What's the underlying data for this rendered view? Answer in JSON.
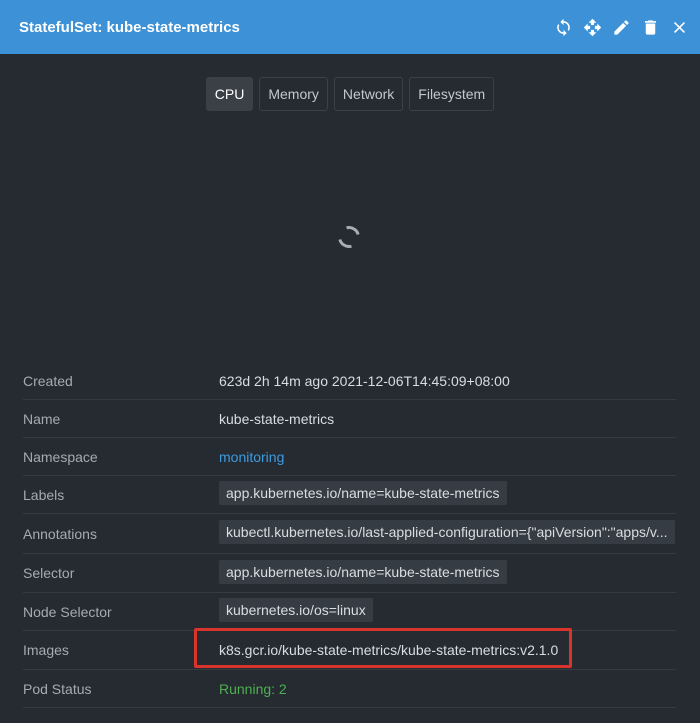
{
  "header": {
    "title": "StatefulSet: kube-state-metrics",
    "actions": [
      "restart-icon",
      "move-icon",
      "edit-icon",
      "delete-icon",
      "close-icon"
    ]
  },
  "tabs": [
    {
      "label": "CPU",
      "active": true
    },
    {
      "label": "Memory",
      "active": false
    },
    {
      "label": "Network",
      "active": false
    },
    {
      "label": "Filesystem",
      "active": false
    }
  ],
  "details": {
    "created": {
      "label": "Created",
      "value": "623d 2h 14m ago 2021-12-06T14:45:09+08:00"
    },
    "name": {
      "label": "Name",
      "value": "kube-state-metrics"
    },
    "namespace": {
      "label": "Namespace",
      "value": "monitoring"
    },
    "labels": {
      "label": "Labels",
      "value": "app.kubernetes.io/name=kube-state-metrics"
    },
    "annotations": {
      "label": "Annotations",
      "value": "kubectl.kubernetes.io/last-applied-configuration={\"apiVersion\":\"apps/v..."
    },
    "selector": {
      "label": "Selector",
      "value": "app.kubernetes.io/name=kube-state-metrics"
    },
    "node_selector": {
      "label": "Node Selector",
      "value": "kubernetes.io/os=linux"
    },
    "images": {
      "label": "Images",
      "value": "k8s.gcr.io/kube-state-metrics/kube-state-metrics:v2.1.0"
    },
    "pod_status": {
      "label": "Pod Status",
      "value": "Running: 2"
    }
  },
  "colors": {
    "header": "#3d91d6",
    "background": "#262b31",
    "link": "#3d9be0",
    "running": "#4caf50",
    "highlight": "#d9342b"
  }
}
